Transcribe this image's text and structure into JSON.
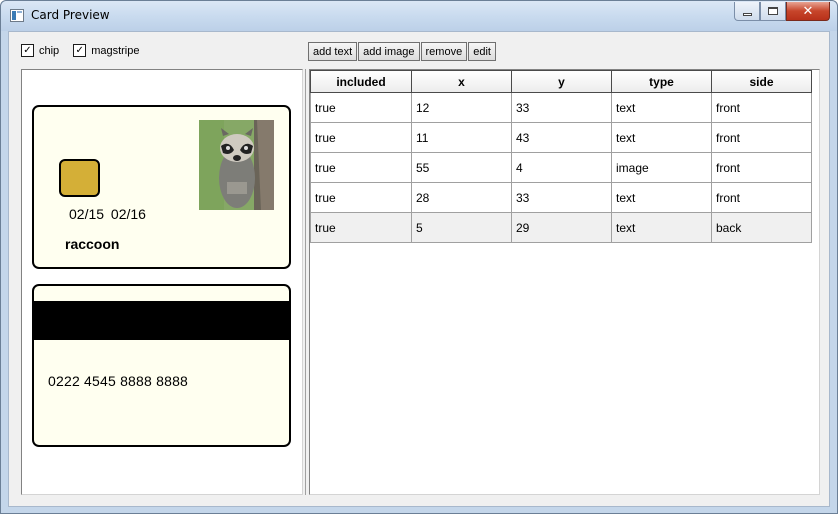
{
  "window": {
    "title": "Card Preview",
    "minimize_glyph": "",
    "maximize_glyph": "",
    "close_glyph": "✕"
  },
  "options": {
    "chip": {
      "label": "chip",
      "checked": true,
      "mark": "✓"
    },
    "magstripe": {
      "label": "magstripe",
      "checked": true,
      "mark": "✓"
    }
  },
  "toolbar": {
    "add_text": "add text",
    "add_image": "add image",
    "remove": "remove",
    "edit": "edit"
  },
  "card_front": {
    "dates": "02/15  02/16",
    "holder": "raccoon",
    "photo_icon": "raccoon-photo",
    "chip_color": "#d4af37",
    "background": "#fffff0"
  },
  "card_back": {
    "number": "0222 4545 8888 8888",
    "stripe_color": "#000000"
  },
  "table": {
    "columns": [
      "included",
      "x",
      "y",
      "type",
      "side"
    ],
    "rows": [
      [
        "true",
        "12",
        "33",
        "text",
        "front"
      ],
      [
        "true",
        "11",
        "43",
        "text",
        "front"
      ],
      [
        "true",
        "55",
        "4",
        "image",
        "front"
      ],
      [
        "true",
        "28",
        "33",
        "text",
        "front"
      ],
      [
        "true",
        "5",
        "29",
        "text",
        "back"
      ]
    ],
    "selected_row": 4
  }
}
